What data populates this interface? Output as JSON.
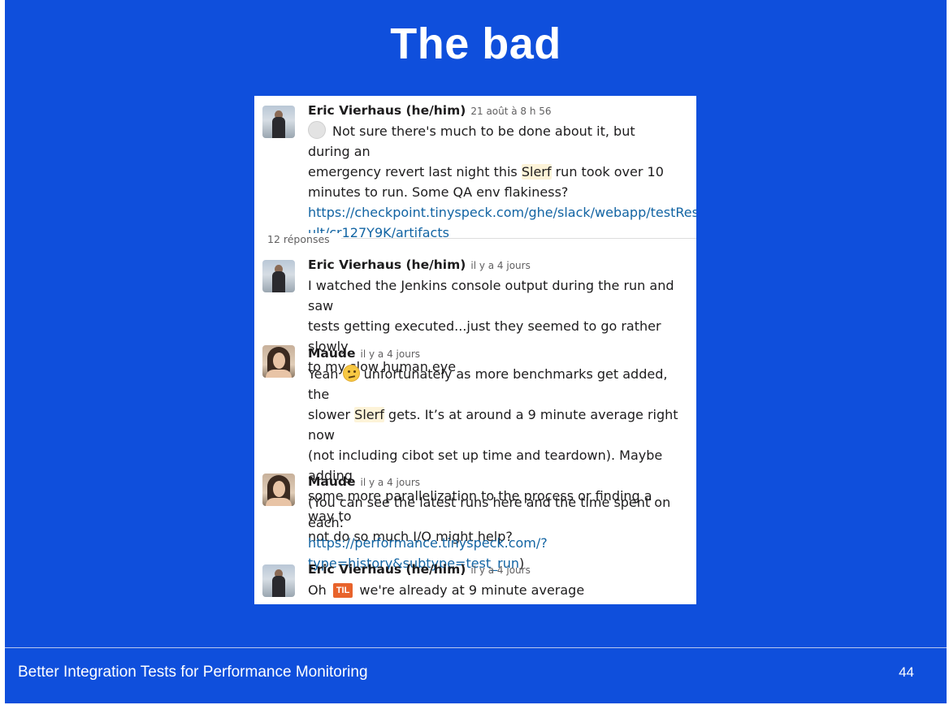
{
  "slide": {
    "title": "The bad",
    "footer": "Better Integration Tests for Performance Monitoring",
    "page_number": "44"
  },
  "thread": {
    "parent": {
      "author": "Eric Vierhaus (he/him)",
      "timestamp": "21 août à 8 h 56",
      "text_1": "Not sure there's much to be done about it, but during an",
      "text_2a": "emergency revert last night this ",
      "text_2_highlight": "Slerf",
      "text_2b": " run took over 10",
      "text_3": "minutes to run. Some QA env flakiness?",
      "link_1": "https://checkpoint.tinyspeck.com/ghe/slack/webapp/testRes",
      "link_2": "ult/cr127Y9K/artifacts"
    },
    "replies_count": "12 réponses",
    "messages": [
      {
        "author": "Eric Vierhaus (he/him)",
        "timestamp": "il y a 4 jours",
        "line_1": "I watched the Jenkins console output during the run and saw",
        "line_2": "tests getting executed...just they seemed to go rather slowly",
        "line_3": "to my slow human eye"
      },
      {
        "author": "Maude",
        "timestamp": "il y a 4 jours",
        "line_1a": "Yeah ",
        "line_1b": " unfortunately as more benchmarks get added, the",
        "line_2a": "slower ",
        "line_2_highlight": "Slerf",
        "line_2b": " gets. It’s at around a 9 minute average right now",
        "line_3": "(not including cibot set up time and teardown). Maybe adding",
        "line_4": "some more parallelization to the process or finding a way to",
        "line_5": "not do so much I/O might help?"
      },
      {
        "author": "Maude",
        "timestamp": "il y a 4 jours",
        "line_1": "(You can see the latest runs here and the time spent on each:",
        "link_1": "https://performance.tinyspeck.com/?",
        "link_2": "type=history&subtype=test_run",
        "line_end": ")"
      },
      {
        "author": "Eric Vierhaus (he/him)",
        "timestamp": "il y a 4 jours",
        "line_1a": "Oh ",
        "badge": "TIL",
        "line_1b": " we're already at 9 minute average"
      }
    ]
  },
  "icons": {
    "status": "status-circle-icon",
    "confused": "confused-face-emoji-icon"
  },
  "colors": {
    "slide_background": "#0f4fdc",
    "link": "#1264a3",
    "highlight": "#fdf3d8",
    "til_badge": "#e8632b"
  }
}
